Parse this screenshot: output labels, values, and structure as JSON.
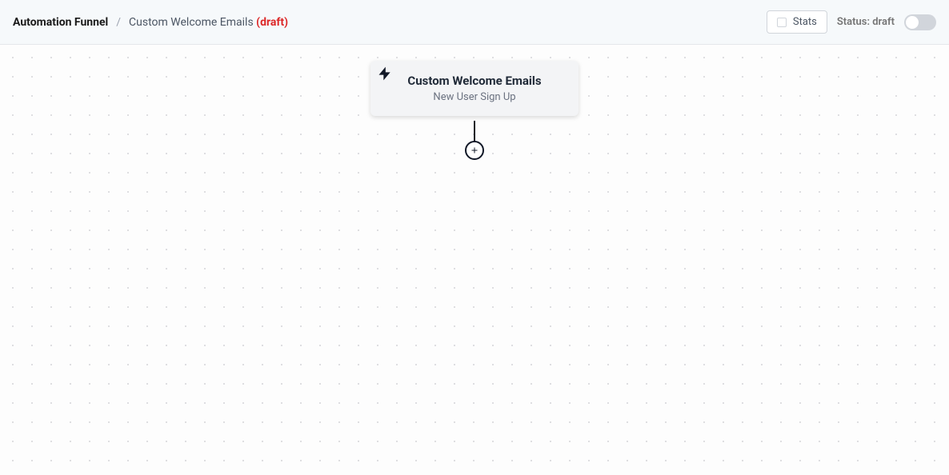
{
  "breadcrumb": {
    "root": "Automation Funnel",
    "separator": "/",
    "current": "Custom Welcome Emails",
    "status_suffix": "(draft)"
  },
  "header": {
    "stats_label": "Stats",
    "status_label": "Status: draft"
  },
  "node": {
    "title": "Custom Welcome Emails",
    "subtitle": "New User Sign Up"
  }
}
